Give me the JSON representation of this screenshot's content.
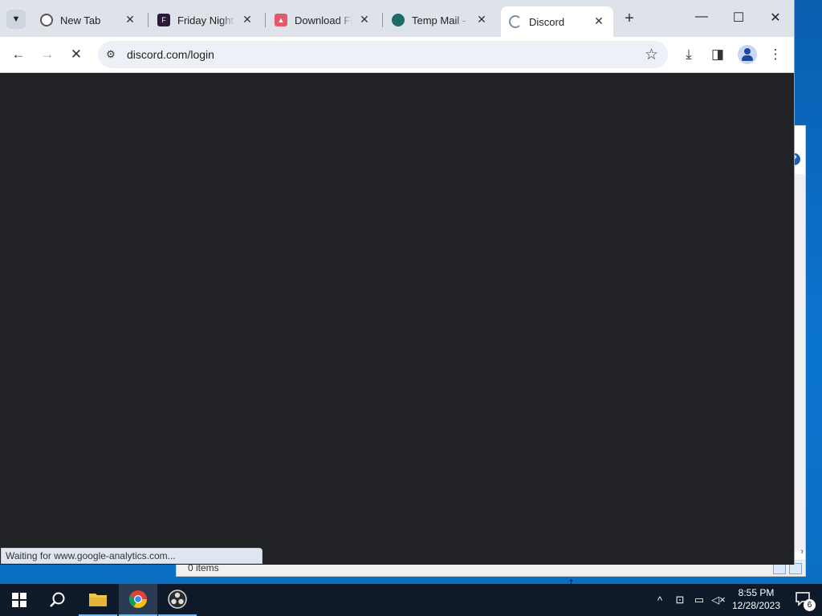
{
  "browser": {
    "tabs": [
      {
        "label": "New Tab",
        "icon": "chrome-icon",
        "active": false
      },
      {
        "label": "Friday Night F",
        "icon": "fnf-logo-icon",
        "active": false
      },
      {
        "label": "Download Fri",
        "icon": "gamejolt-icon",
        "active": false
      },
      {
        "label": "Temp Mail - D",
        "icon": "tempmail-icon",
        "active": false
      },
      {
        "label": "Discord",
        "icon": "loading-spinner-icon",
        "active": true
      }
    ],
    "address": "discord.com/login",
    "status_text": "Waiting for www.google-analytics.com...",
    "page_background": "#202225",
    "tabstrip_color": "#dee3ea"
  },
  "explorer": {
    "status": "0 items"
  },
  "taskbar": {
    "apps": [
      "start-icon",
      "search-icon",
      "file-explorer-icon",
      "chrome-icon",
      "obs-icon"
    ],
    "clock_time": "8:55 PM",
    "clock_date": "12/28/2023",
    "notification_count": "6"
  }
}
